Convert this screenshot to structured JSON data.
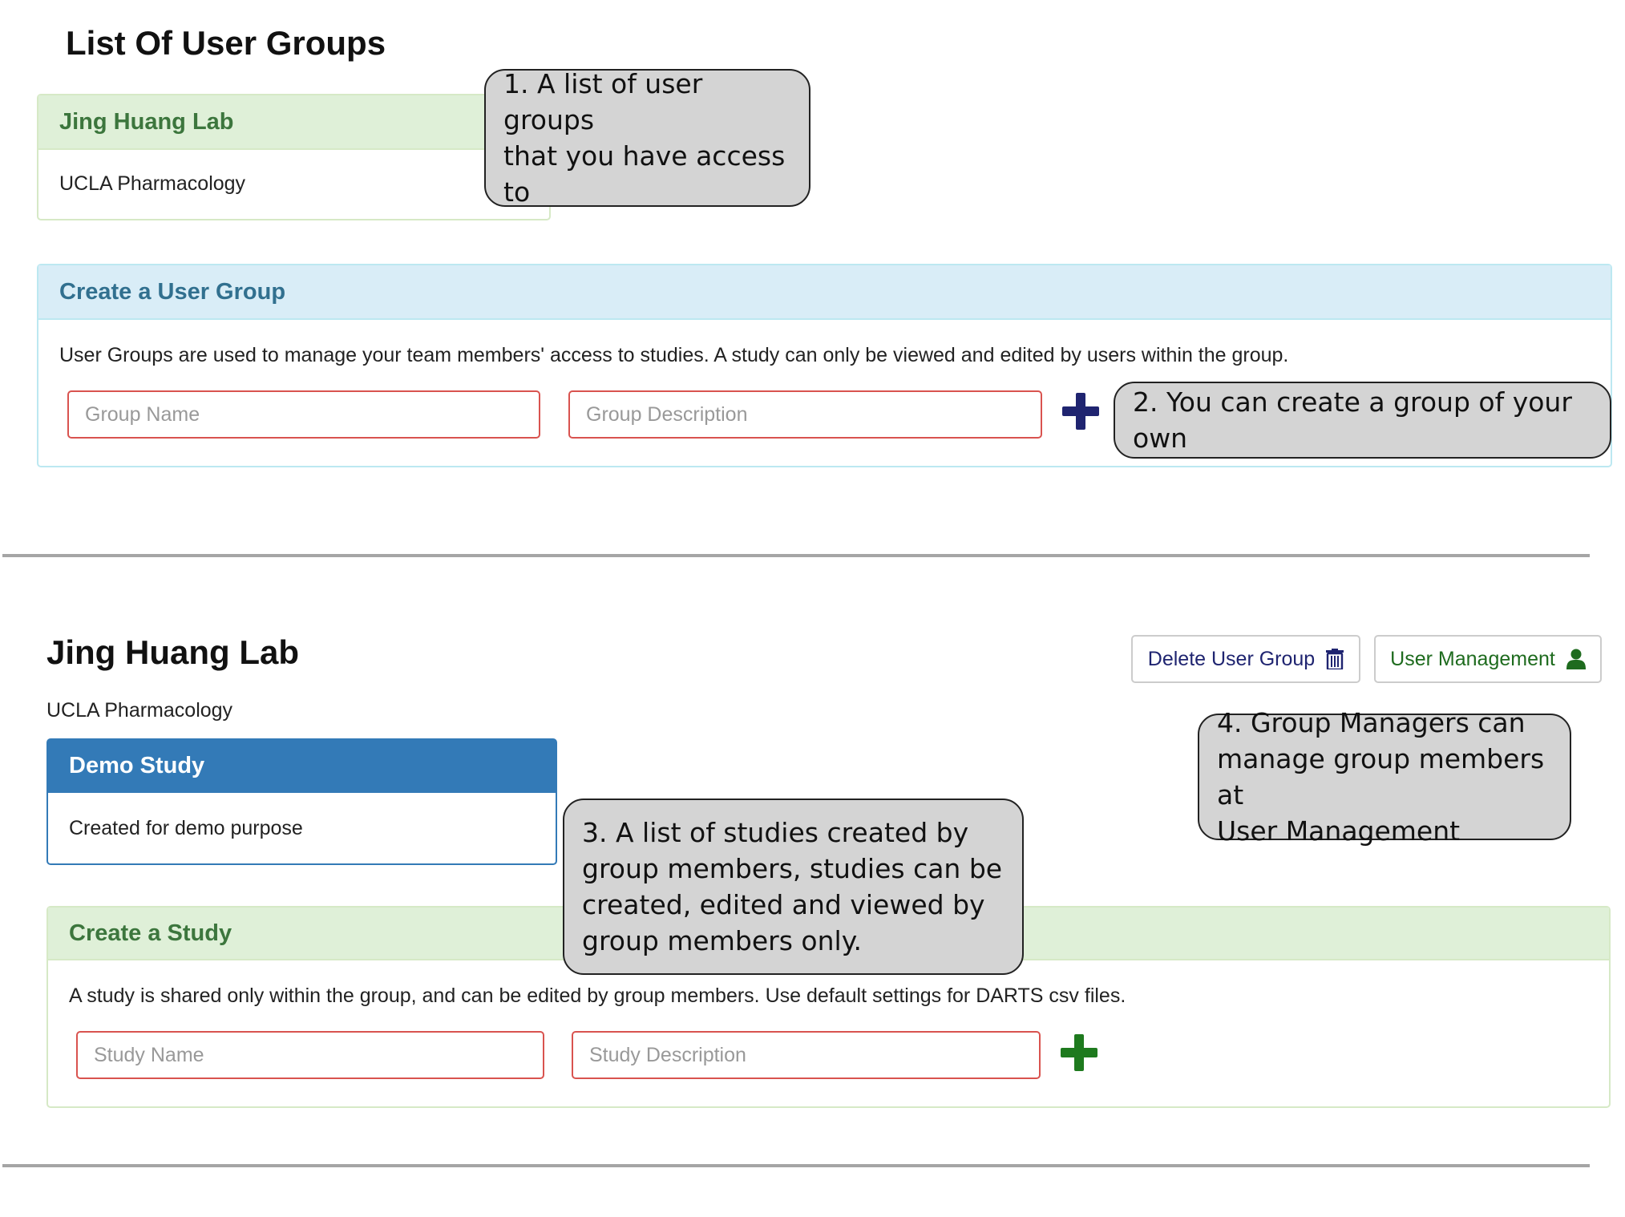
{
  "user_groups_section": {
    "title": "List Of User Groups",
    "groups": [
      {
        "name": "Jing Huang Lab",
        "description": "UCLA Pharmacology"
      }
    ]
  },
  "create_group": {
    "heading": "Create a User Group",
    "help_text": "User Groups are used to manage your team members' access to studies. A study can only be viewed and edited by users within the group.",
    "name_placeholder": "Group Name",
    "description_placeholder": "Group Description",
    "add_icon": "plus-icon",
    "add_color": "#1f2470"
  },
  "group_detail": {
    "title": "Jing Huang Lab",
    "subtitle": "UCLA Pharmacology",
    "delete_button": {
      "label": "Delete User Group",
      "icon": "trash-icon",
      "color": "#1f2470"
    },
    "user_management_button": {
      "label": "User Management",
      "icon": "user-icon",
      "color": "#1e6b1e"
    },
    "studies": [
      {
        "name": "Demo Study",
        "description": "Created for demo purpose"
      }
    ]
  },
  "create_study": {
    "heading": "Create a Study",
    "help_text": "A study is shared only within the group, and can be edited by group members. Use default settings for DARTS csv files.",
    "name_placeholder": "Study Name",
    "description_placeholder": "Study Description",
    "add_icon": "plus-icon",
    "add_color": "#1e7a1e"
  },
  "callouts": [
    "1. A list of user groups\nthat you have access to",
    "2. You can create a group of your own",
    "3. A list of studies created by\ngroup members, studies can be\ncreated, edited and viewed by\ngroup members only.",
    "4. Group Managers can\nmanage group members at\nUser Management"
  ]
}
